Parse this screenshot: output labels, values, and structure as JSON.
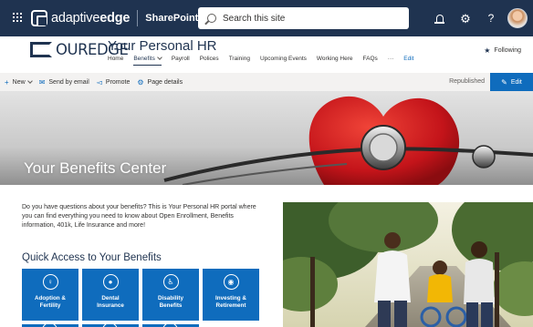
{
  "suite_bar": {
    "brand_regular": "adaptive",
    "brand_bold": "edge",
    "app_label": "SharePoint",
    "search_placeholder": "Search this site",
    "icons": [
      "waffle-icon",
      "bell-icon",
      "gear-icon",
      "help-icon",
      "avatar"
    ]
  },
  "site_header": {
    "logo_text": "OUREDGE",
    "title": "Your Personal HR",
    "nav": [
      {
        "label": "Home",
        "active": false
      },
      {
        "label": "Benefits",
        "active": true,
        "has_dropdown": true
      },
      {
        "label": "Payroll",
        "active": false
      },
      {
        "label": "Polices",
        "active": false
      },
      {
        "label": "Training",
        "active": false
      },
      {
        "label": "Upcoming Events",
        "active": false
      },
      {
        "label": "Working Here",
        "active": false
      },
      {
        "label": "FAQs",
        "active": false
      }
    ],
    "more_label": "···",
    "edit_label": "Edit",
    "follow_label": "Following"
  },
  "command_bar": {
    "new_label": "New",
    "send_label": "Send by email",
    "promote_label": "Promote",
    "details_label": "Page details",
    "status": "Republished",
    "edit_label": "Edit"
  },
  "hero": {
    "title": "Your Benefits Center"
  },
  "intro_text": "Do you have questions about your benefits?  This is Your Personal HR portal where you can find everything you need to know about Open Enrollment, Benefits information, 401k, Life Insurance and more!",
  "quick_access": {
    "title": "Quick Access to Your Benefits",
    "tiles": [
      {
        "label_1": "Adoption &",
        "label_2": "Fertility",
        "glyph": "♀"
      },
      {
        "label_1": "Dental",
        "label_2": "Insurance",
        "glyph": "●"
      },
      {
        "label_1": "Disability",
        "label_2": "Benefits",
        "glyph": "♿"
      },
      {
        "label_1": "Investing &",
        "label_2": "Retirement",
        "glyph": "◉"
      }
    ]
  },
  "colors": {
    "suite_bar": "#1f3350",
    "accent": "#0f6cbd",
    "command_bar": "#f3f2f1"
  }
}
